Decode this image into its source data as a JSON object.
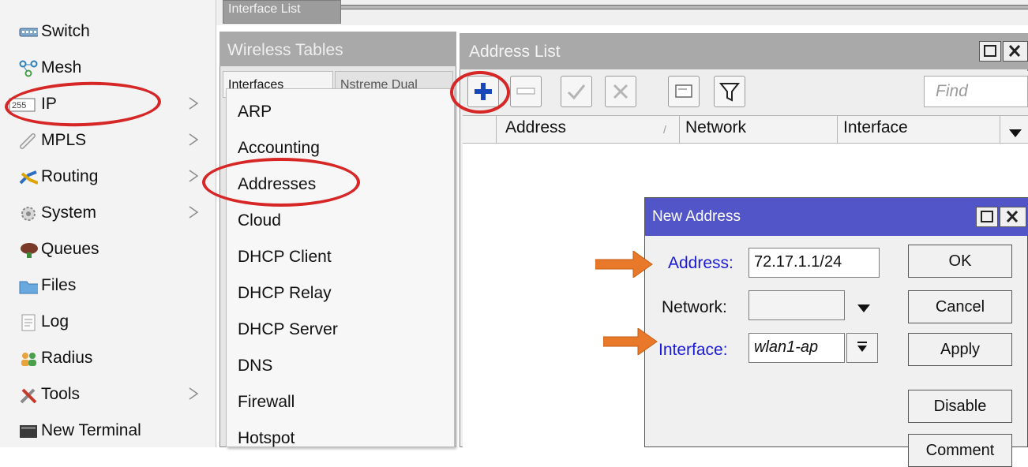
{
  "sidebar": {
    "items": [
      {
        "label": "Switch",
        "icon": "switch-icon",
        "submenu": false
      },
      {
        "label": "Mesh",
        "icon": "mesh-icon",
        "submenu": false
      },
      {
        "label": "IP",
        "icon": "ip-icon",
        "submenu": true
      },
      {
        "label": "MPLS",
        "icon": "mpls-icon",
        "submenu": true
      },
      {
        "label": "Routing",
        "icon": "routing-icon",
        "submenu": true
      },
      {
        "label": "System",
        "icon": "system-icon",
        "submenu": true
      },
      {
        "label": "Queues",
        "icon": "queues-icon",
        "submenu": false
      },
      {
        "label": "Files",
        "icon": "folder-icon",
        "submenu": false
      },
      {
        "label": "Log",
        "icon": "log-icon",
        "submenu": false
      },
      {
        "label": "Radius",
        "icon": "radius-icon",
        "submenu": false
      },
      {
        "label": "Tools",
        "icon": "tools-icon",
        "submenu": true
      },
      {
        "label": "New Terminal",
        "icon": "terminal-icon",
        "submenu": false
      }
    ]
  },
  "background_windows": {
    "interface_list_tab": "Interface List",
    "wireless_tables_title": "Wireless Tables",
    "wireless_tab1": "Interfaces",
    "wireless_tab2": "Nstreme Dual"
  },
  "ip_submenu": {
    "items": [
      "ARP",
      "Accounting",
      "Addresses",
      "Cloud",
      "DHCP Client",
      "DHCP Relay",
      "DHCP Server",
      "DNS",
      "Firewall",
      "Hotspot"
    ]
  },
  "address_list": {
    "title": "Address List",
    "find_placeholder": "Find",
    "columns": [
      "Address",
      "Network",
      "Interface"
    ],
    "sort_indicator": "/"
  },
  "new_address": {
    "title": "New Address",
    "address_label": "Address:",
    "address_value": "72.17.1.1/24",
    "network_label": "Network:",
    "network_value": "",
    "interface_label": "Interface:",
    "interface_value": "wlan1-ap",
    "buttons": {
      "ok": "OK",
      "cancel": "Cancel",
      "apply": "Apply",
      "disable": "Disable",
      "comment": "Comment"
    }
  },
  "colors": {
    "annotation_red": "#d62626",
    "annotation_orange": "#e8792a",
    "dialog_title": "#5255c8",
    "label_blue": "#1a1ad8"
  }
}
